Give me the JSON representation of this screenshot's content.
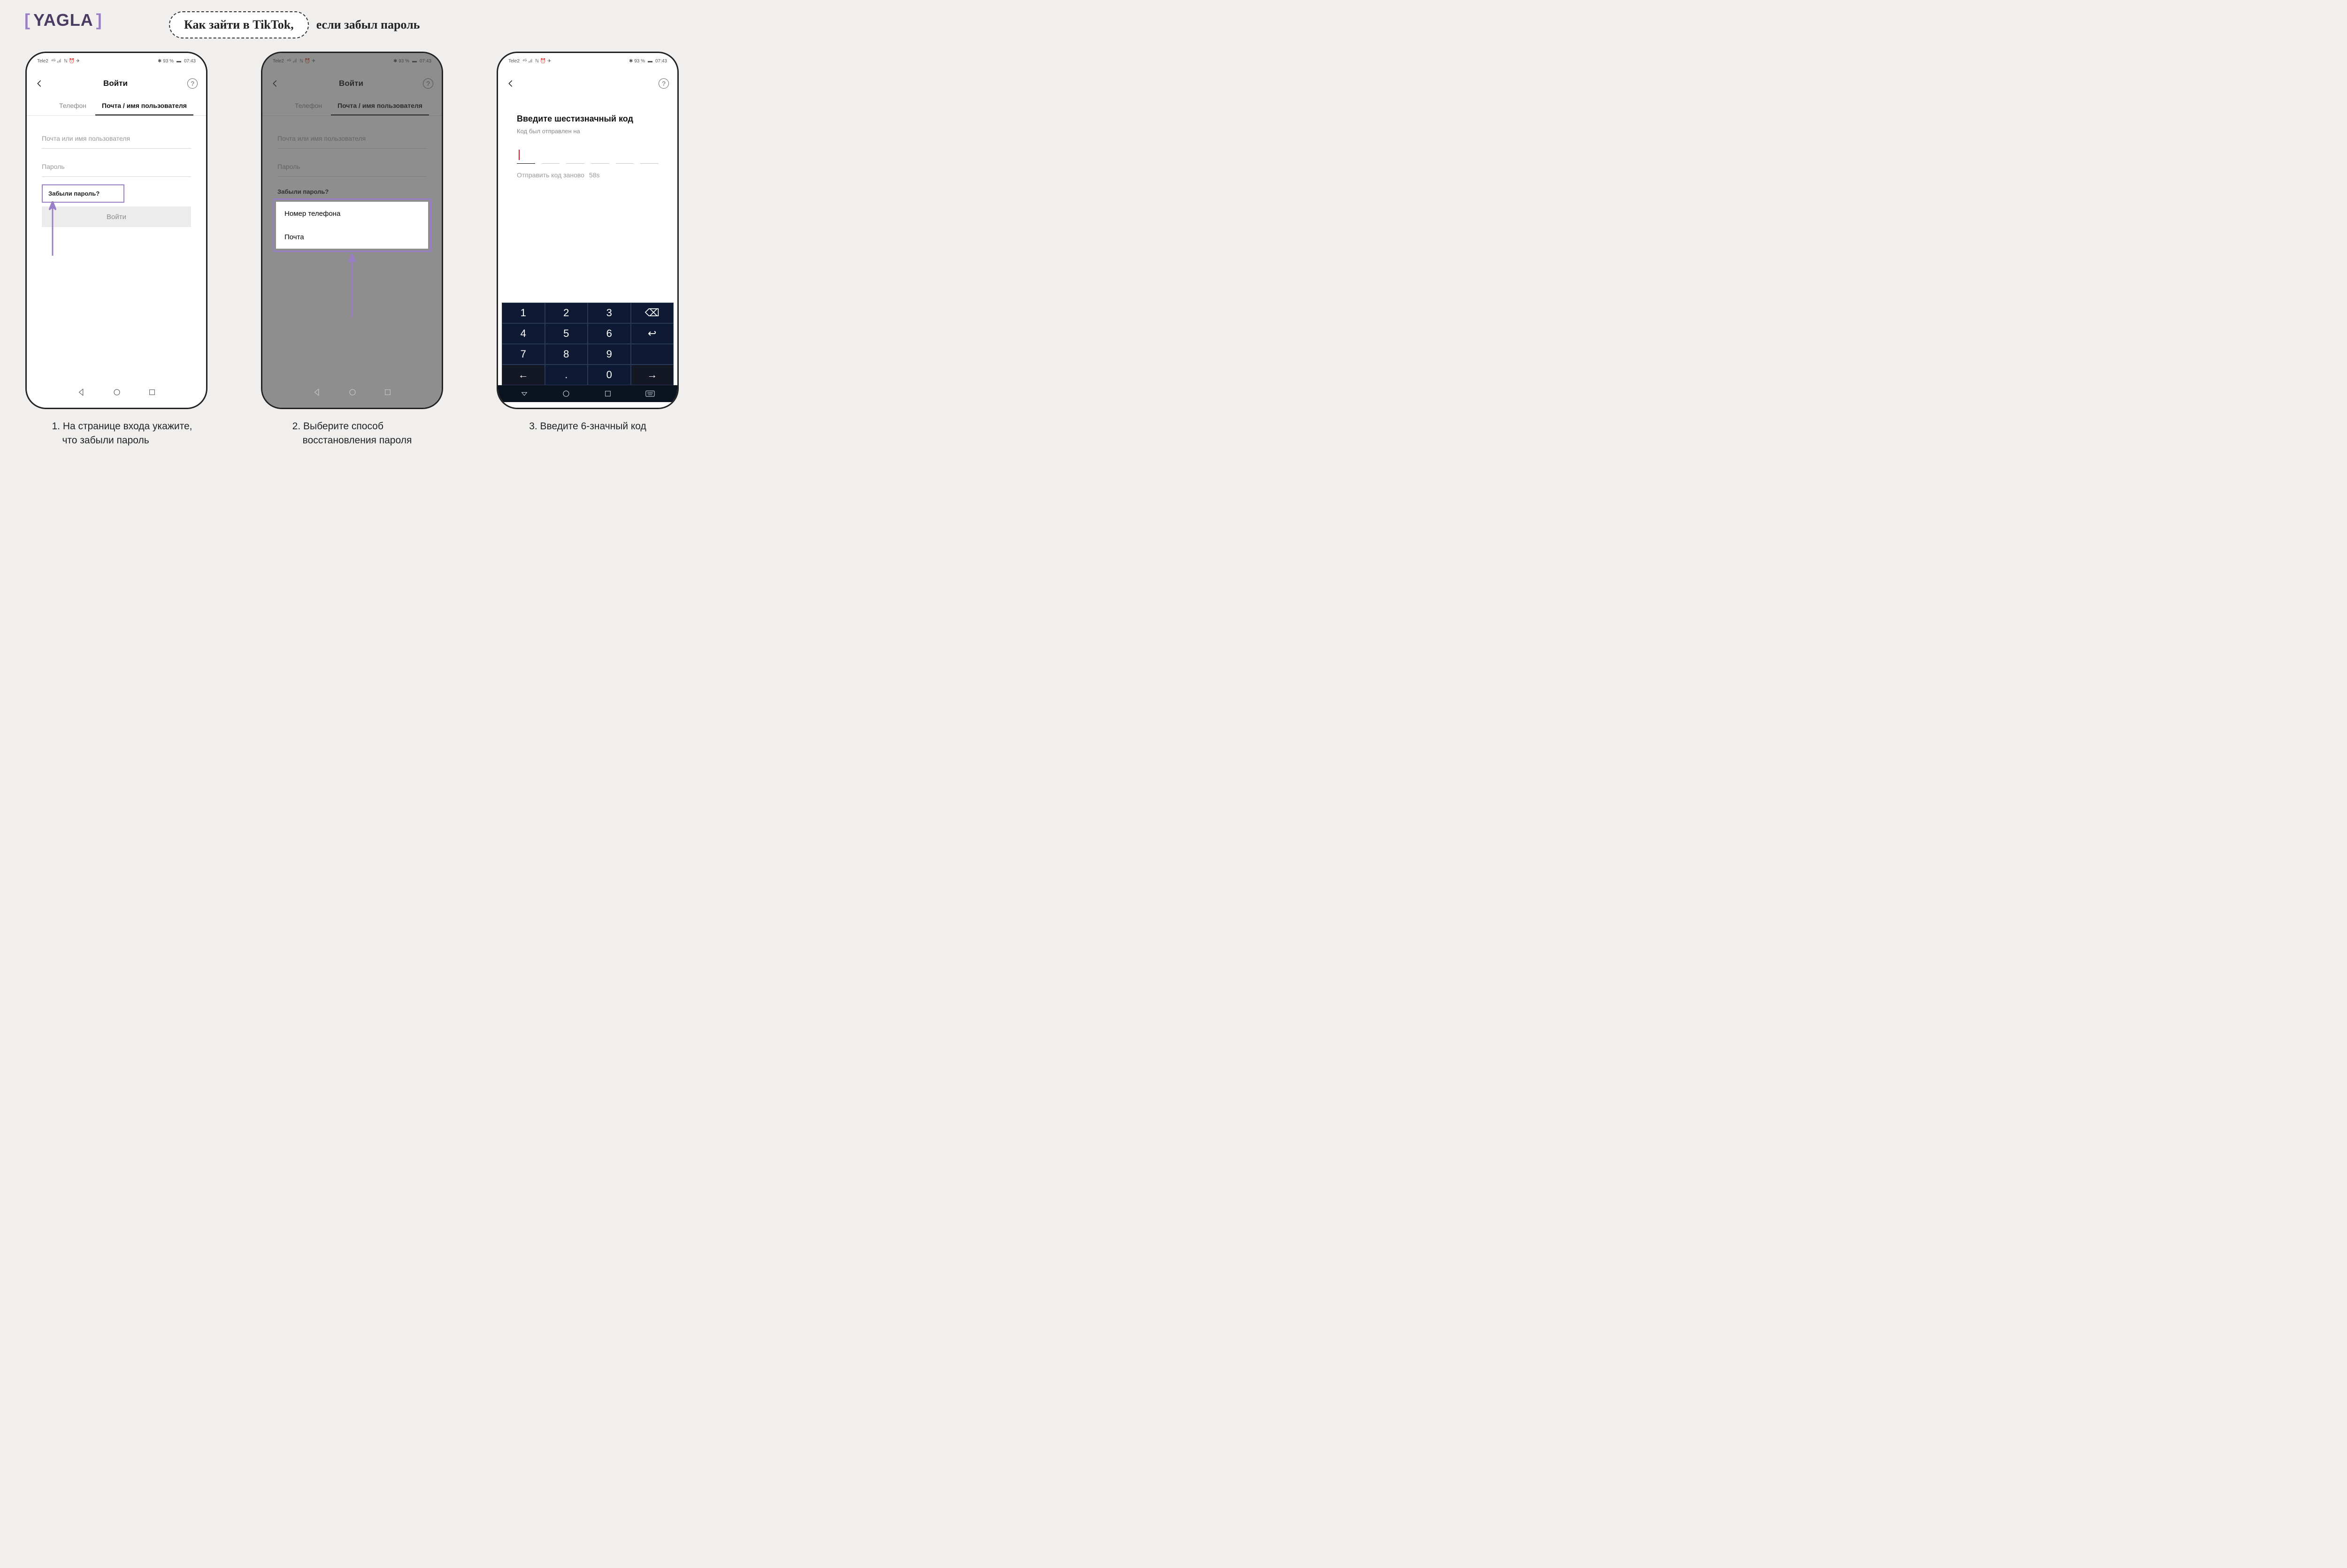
{
  "brand": "YAGLA",
  "title_pill": "Как зайти в TikTok,",
  "title_tail": "если забыл пароль",
  "status": {
    "carrier": "Tele2",
    "signal": "⁴ᴳ ₄ıl",
    "icons": "ℕ ⏰ ✈",
    "bt": "✱ 93 %",
    "time": "07:43"
  },
  "phone1": {
    "header": "Войти",
    "tab_phone": "Телефон",
    "tab_email": "Почта / имя пользователя",
    "placeholder_user": "Почта или имя пользователя",
    "placeholder_pass": "Пароль",
    "forgot": "Забыли пароль?",
    "login_btn": "Войти"
  },
  "phone2": {
    "sheet_phone": "Номер телефона",
    "sheet_email": "Почта"
  },
  "phone3": {
    "code_title": "Введите шестизначный код",
    "code_sub": "Код был отправлен на",
    "resend_label": "Отправить код заново",
    "resend_timer": "58s",
    "keypad": {
      "r1": [
        "1",
        "2",
        "3",
        "⌫"
      ],
      "r2": [
        "4",
        "5",
        "6",
        "↩"
      ],
      "r3": [
        "7",
        "8",
        "9"
      ],
      "r4": [
        "←",
        ".",
        "0",
        "→"
      ]
    }
  },
  "captions": {
    "c1_l1": "1. На странице входа укажите,",
    "c1_l2": "что забыли пароль",
    "c2_l1": "2. Выберите способ",
    "c2_l2": "восстановления пароля",
    "c3": "3. Введите 6-значный код"
  }
}
